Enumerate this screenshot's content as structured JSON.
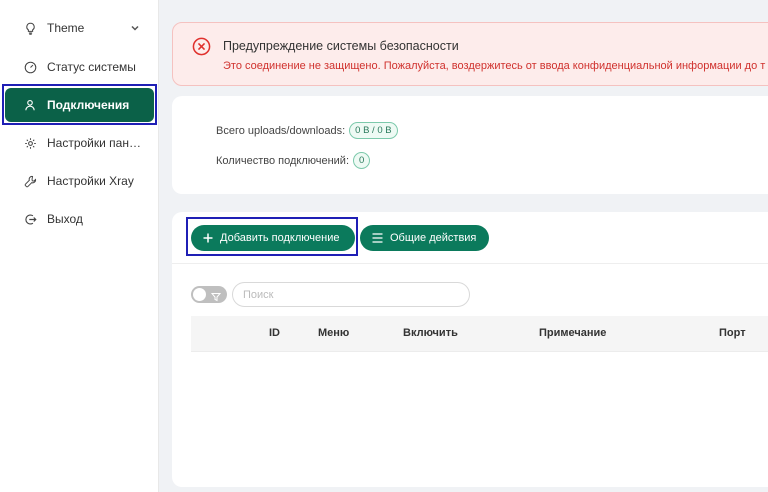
{
  "sidebar": {
    "items": [
      {
        "label": "Theme",
        "icon": "lightbulb-icon"
      },
      {
        "label": "Статус системы",
        "icon": "dashboard-icon"
      },
      {
        "label": "Подключения",
        "icon": "user-icon"
      },
      {
        "label": "Настройки панели",
        "icon": "gear-icon"
      },
      {
        "label": "Настройки Xray",
        "icon": "tool-icon"
      },
      {
        "label": "Выход",
        "icon": "logout-icon"
      }
    ]
  },
  "alert": {
    "title": "Предупреждение системы безопасности",
    "message": "Это соединение не защищено. Пожалуйста, воздержитесь от ввода конфиденциальной информации до т"
  },
  "stats": {
    "traffic_label": "Всего uploads/downloads:",
    "traffic_value": "0 B / 0 B",
    "connections_label": "Количество подключений:",
    "connections_value": "0"
  },
  "toolbar": {
    "add_label": "Добавить подключение",
    "general_label": "Общие действия"
  },
  "search": {
    "placeholder": "Поиск"
  },
  "table": {
    "columns": [
      "ID",
      "Меню",
      "Включить",
      "Примечание",
      "Порт"
    ]
  },
  "colors": {
    "accent": "#0b7a5c",
    "sidebar_active": "#0b6148",
    "alert_bg": "#fdeceb",
    "alert_text": "#d0312d",
    "selection_outline": "#1f1fb5"
  }
}
